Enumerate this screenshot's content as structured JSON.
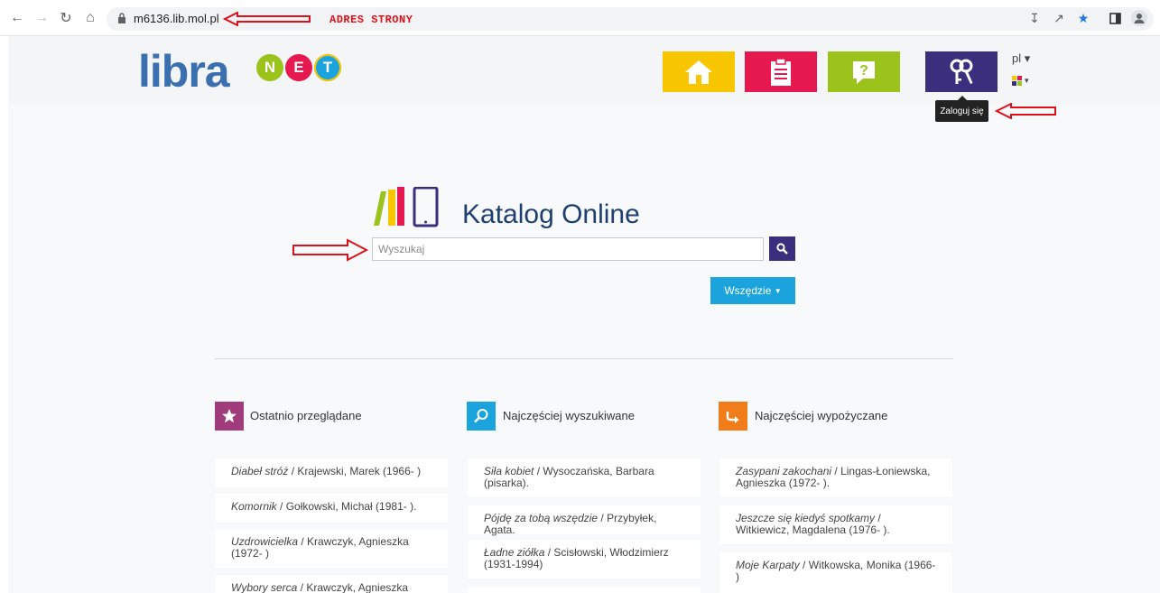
{
  "browser": {
    "url": "m6136.lib.mol.pl",
    "annotation_address": "ADRES STRONY"
  },
  "header": {
    "logo_text": "libra",
    "logo_net_letters": [
      "N",
      "E",
      "T"
    ],
    "lang": "pl",
    "login_tooltip": "Zaloguj się",
    "colors": {
      "home": "#f7c600",
      "clipboard": "#e5184f",
      "help": "#9bc31c",
      "login": "#3b2f7d"
    }
  },
  "catalog": {
    "title": "Katalog Online",
    "search_placeholder": "Wyszukaj",
    "scope_button": "Wszędzie"
  },
  "columns": {
    "recent": {
      "title": "Ostatnio przeglądane",
      "items": [
        {
          "title": "Diabeł stróż",
          "rest": " / Krajewski, Marek (1966- )"
        },
        {
          "title": "Komornik",
          "rest": " / Gołkowski, Michał (1981- )."
        },
        {
          "title": "Uzdrowicielka",
          "rest": " / Krawczyk, Agnieszka (1972- )"
        },
        {
          "title": "Wybory serca",
          "rest": " / Krawczyk, Agnieszka"
        }
      ]
    },
    "searched": {
      "title": "Najczęściej wyszukiwane",
      "items": [
        {
          "title": "Siła kobiet",
          "rest": " / Wysoczańska, Barbara (pisarka)."
        },
        {
          "title": "Pójdę za tobą wszędzie",
          "rest": " / Przybyłek, Agata."
        },
        {
          "title": "Ładne ziółka",
          "rest": " / Scisłowski, Włodzimierz (1931-1994)"
        }
      ]
    },
    "borrowed": {
      "title": "Najczęściej wypożyczane",
      "items": [
        {
          "title": "Zasypani zakochani",
          "rest": " / Lingas-Łoniewska, Agnieszka (1972- )."
        },
        {
          "title": "Jeszcze się kiedyś spotkamy",
          "rest": " / Witkiewicz, Magdalena (1976- )."
        },
        {
          "title": "Moje Karpaty",
          "rest": " / Witkowska, Monika (1966- )"
        }
      ]
    }
  }
}
